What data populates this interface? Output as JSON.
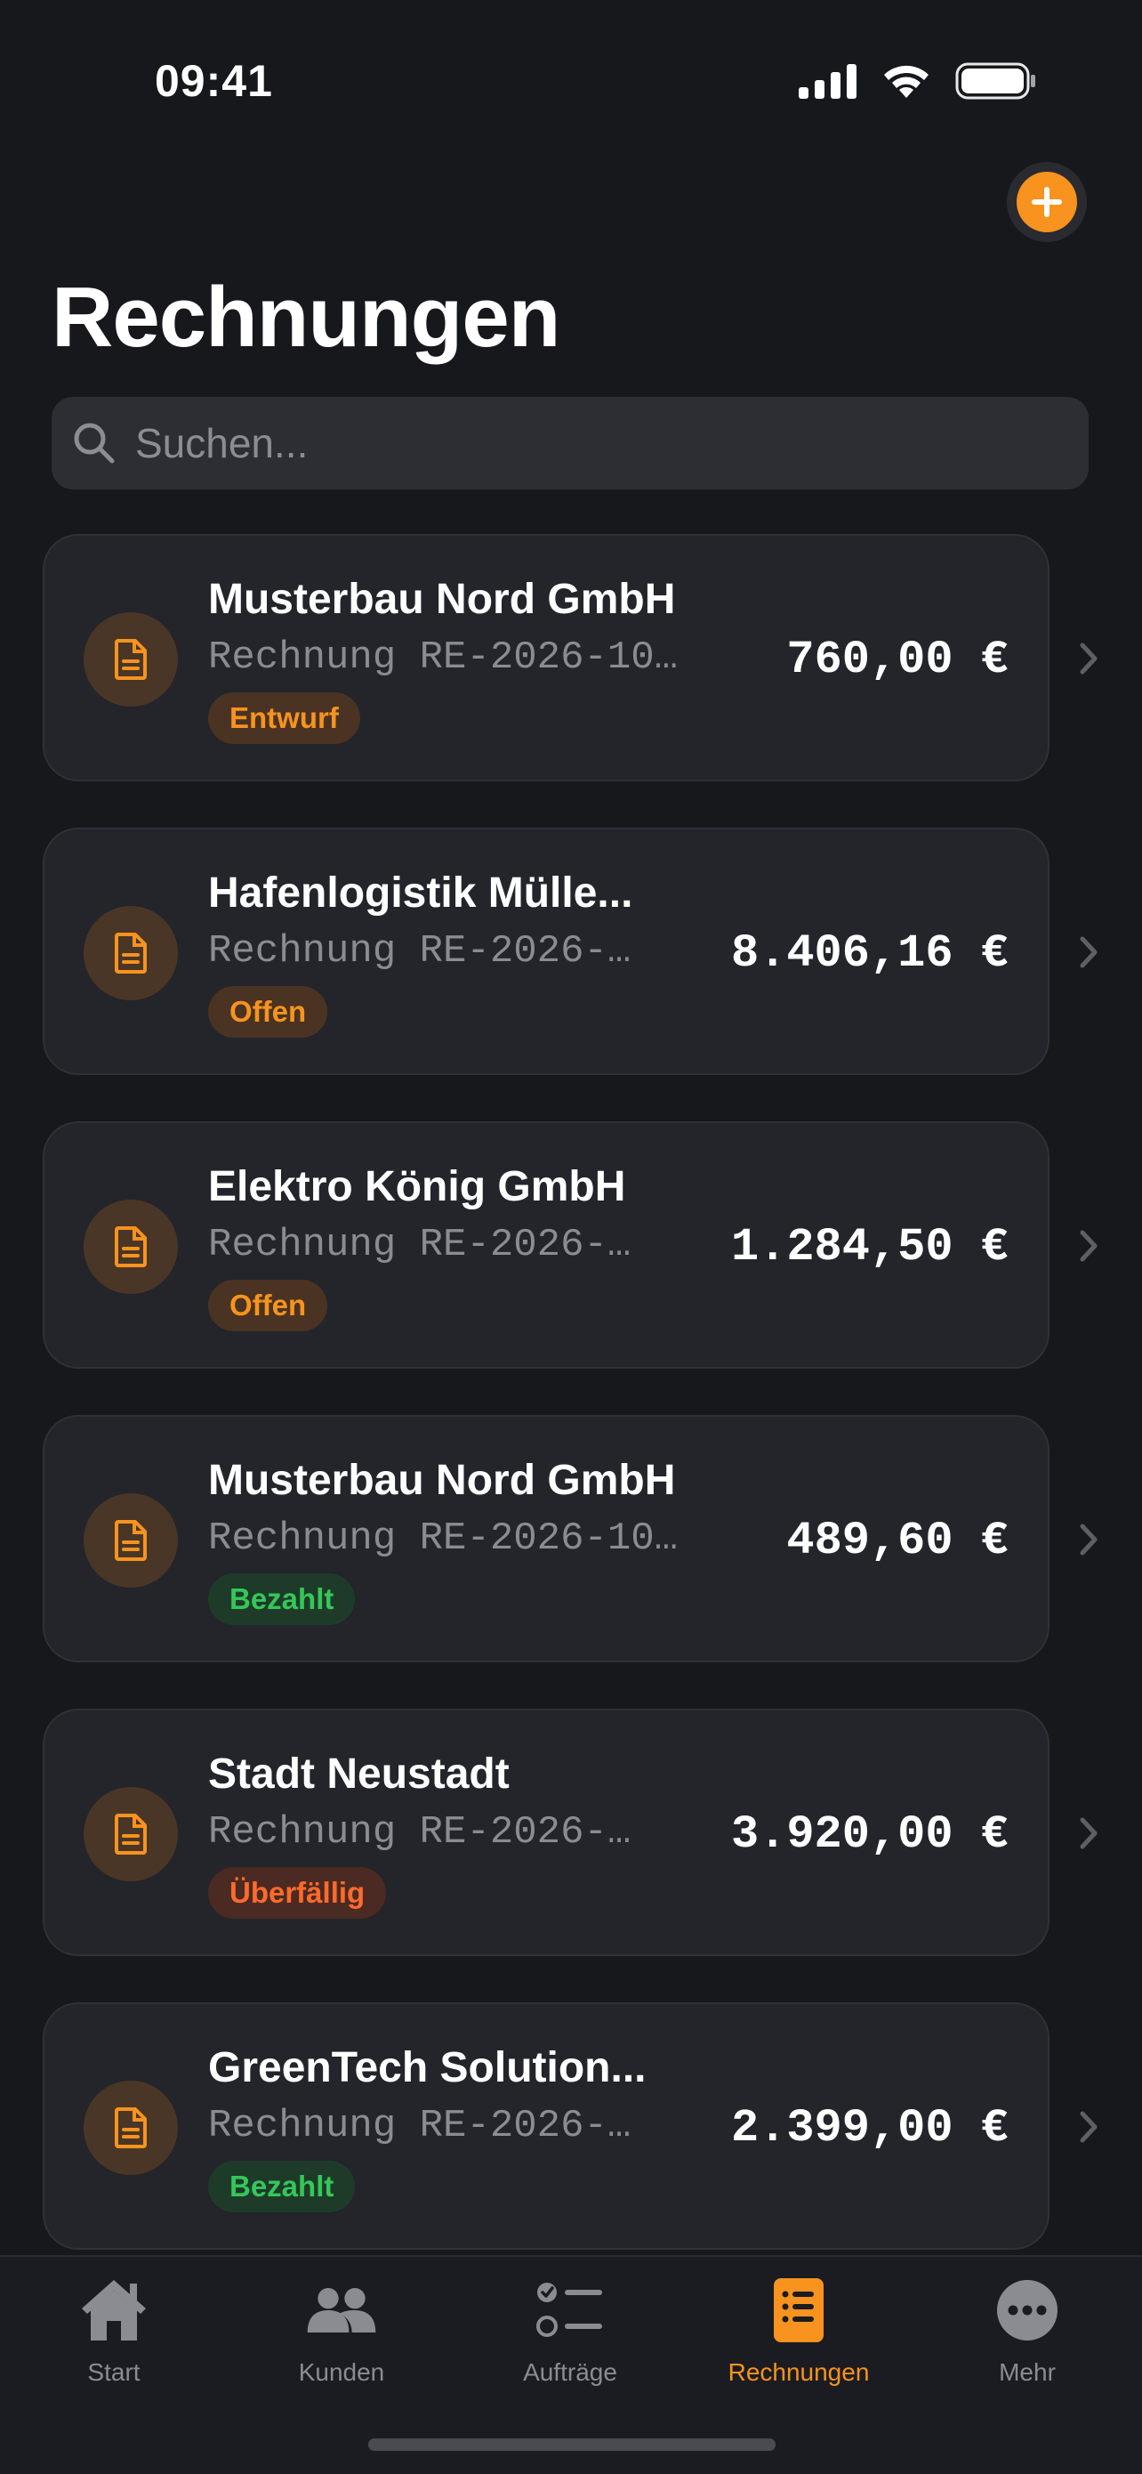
{
  "status_bar": {
    "time": "09:41"
  },
  "header": {
    "title": "Rechnungen"
  },
  "search": {
    "placeholder": "Suchen..."
  },
  "invoices": [
    {
      "client": "Musterbau Nord GmbH",
      "number": "Rechnung RE-2026-10…",
      "status": "Entwurf",
      "status_type": "draft",
      "amount": "760,00 €"
    },
    {
      "client": "Hafenlogistik Mülle...",
      "number": "Rechnung RE-2026-…",
      "status": "Offen",
      "status_type": "open",
      "amount": "8.406,16 €"
    },
    {
      "client": "Elektro König GmbH",
      "number": "Rechnung RE-2026-…",
      "status": "Offen",
      "status_type": "open",
      "amount": "1.284,50 €"
    },
    {
      "client": "Musterbau Nord GmbH",
      "number": "Rechnung RE-2026-10…",
      "status": "Bezahlt",
      "status_type": "paid",
      "amount": "489,60 €"
    },
    {
      "client": "Stadt Neustadt",
      "number": "Rechnung RE-2026-…",
      "status": "Überfällig",
      "status_type": "overdue",
      "amount": "3.920,00 €"
    },
    {
      "client": "GreenTech Solution...",
      "number": "Rechnung RE-2026-…",
      "status": "Bezahlt",
      "status_type": "paid",
      "amount": "2.399,00 €"
    }
  ],
  "tabs": [
    {
      "label": "Start",
      "icon": "house-icon"
    },
    {
      "label": "Kunden",
      "icon": "people-icon"
    },
    {
      "label": "Aufträge",
      "icon": "checklist-icon"
    },
    {
      "label": "Rechnungen",
      "icon": "document-list-icon",
      "active": true
    },
    {
      "label": "Mehr",
      "icon": "ellipsis-circle-icon"
    }
  ],
  "colors": {
    "accent": "#f7931e",
    "background": "#17181c",
    "card": "#23252b",
    "paid": "#34c759",
    "overdue": "#ff6a2b"
  }
}
